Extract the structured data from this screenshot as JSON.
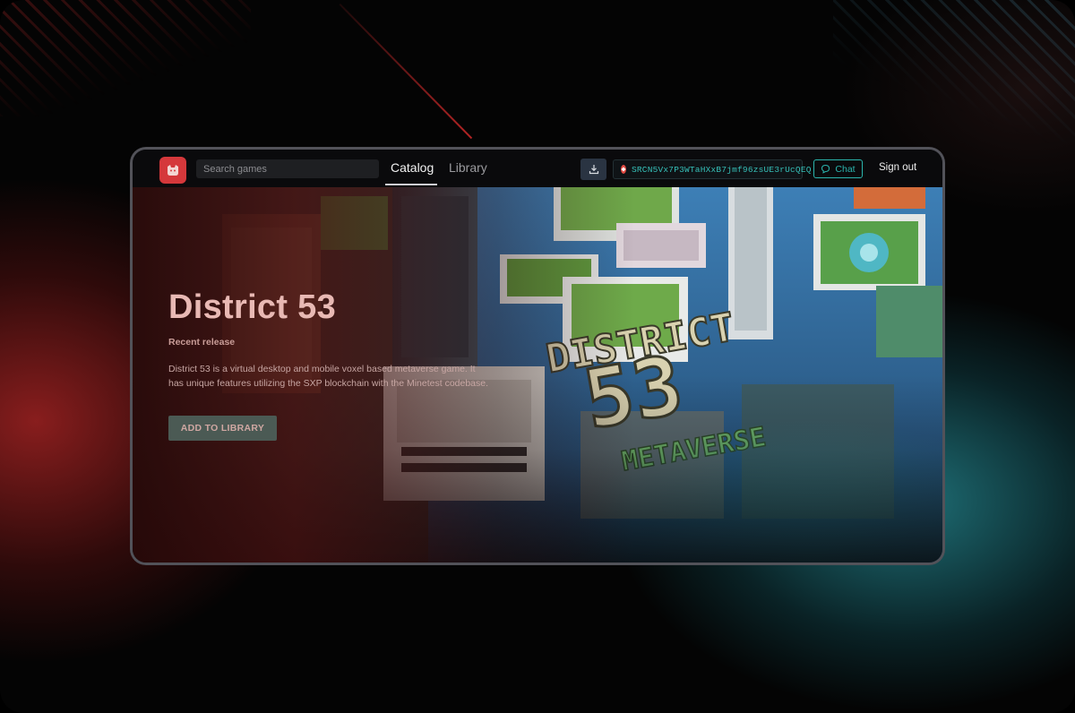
{
  "app": {
    "search": {
      "placeholder": "Search games"
    },
    "tabs": [
      {
        "label": "Catalog",
        "active": true
      },
      {
        "label": "Library",
        "active": false
      }
    ],
    "wallet": {
      "address": "SRCN5Vx7P3WTaHXxB7jmf96zsUE3rUcQEQ"
    },
    "chat_label": "Chat",
    "signout_label": "Sign out"
  },
  "hero": {
    "title": "District 53",
    "subtitle": "Recent release",
    "description": "District 53 is a virtual desktop and mobile voxel based metaverse game. It has unique features utilizing the SXP blockchain with the Minetest codebase.",
    "cta_label": "ADD TO LIBRARY",
    "artwork_text": {
      "line1": "DISTRICT",
      "line2": "53",
      "line3": "METAVERSE"
    }
  },
  "colors": {
    "accent_red": "#d5383b",
    "accent_teal": "#2bb5ad",
    "wallet_text": "#36c0b9"
  },
  "icons": [
    "app-logo-icon",
    "download-icon",
    "wallet-token-icon",
    "chat-bubble-icon"
  ]
}
